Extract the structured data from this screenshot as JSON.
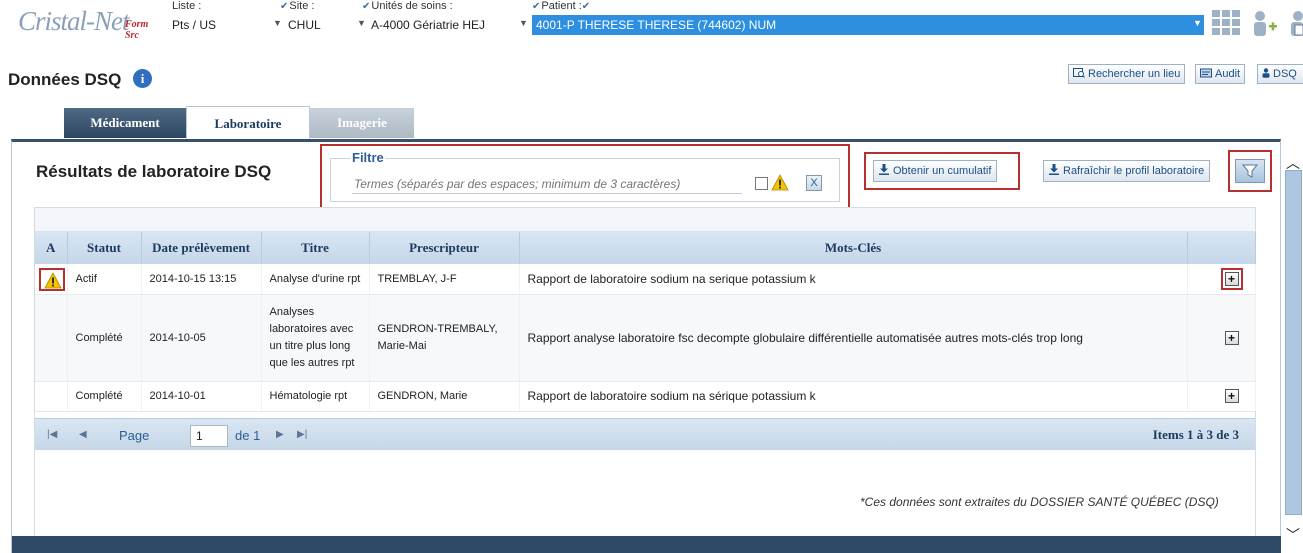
{
  "app": {
    "logo": "Cristal-Net",
    "form_src_line1": "Form",
    "form_src_line2": "Src"
  },
  "selectors": {
    "liste": {
      "label": "Liste :",
      "value": "Pts / US"
    },
    "site": {
      "label": "Site :",
      "value": "CHUL"
    },
    "unite": {
      "label": "Unités de soins :",
      "value": "A-4000 Gériatrie HEJ"
    },
    "patient": {
      "label": "Patient :",
      "value": "4001-P THERESE THERESE (744602) NUM"
    }
  },
  "header": {
    "title": "Données DSQ",
    "info_glyph": "i",
    "buttons": {
      "rechercher": "Rechercher un lieu",
      "audit": "Audit",
      "dsq": "DSQ"
    }
  },
  "tabs": [
    {
      "label": "Médicament"
    },
    {
      "label": "Laboratoire"
    },
    {
      "label": "Imagerie"
    }
  ],
  "panel": {
    "title": "Résultats de laboratoire DSQ",
    "filter": {
      "legend": "Filtre",
      "placeholder": "Termes (séparés par des espaces; minimum de 3 caractères)",
      "clear": "X"
    },
    "buttons": {
      "cumulatif": "Obtenir un cumulatif",
      "rafraichir": "Rafraîchir le profil laboratoire"
    }
  },
  "table": {
    "headers": [
      "A",
      "Statut",
      "Date prélèvement",
      "Titre",
      "Prescripteur",
      "Mots-Clés",
      ""
    ],
    "rows": [
      {
        "statut": "Actif",
        "date": "2014-10-15 13:15",
        "titre": "Analyse d'urine rpt",
        "prescripteur": "TREMBLAY, J-F",
        "mots_cles": "Rapport de laboratoire sodium na serique potassium k"
      },
      {
        "statut": "Complété",
        "date": "2014-10-05",
        "titre": "Analyses laboratoires avec un titre plus long que les autres rpt",
        "prescripteur": "GENDRON-TREMBALY, Marie-Mai",
        "mots_cles": "Rapport analyse laboratoire fsc decompte globulaire différentielle automatisée autres mots-clés trop long"
      },
      {
        "statut": "Complété",
        "date": "2014-10-01",
        "titre": "Hématologie rpt",
        "prescripteur": "GENDRON, Marie",
        "mots_cles": "Rapport de laboratoire sodium na sérique potassium k"
      }
    ],
    "expand_glyph": "+"
  },
  "pager": {
    "page_label": "Page",
    "page_value": "1",
    "of_label": "de 1",
    "items": "Items 1 à 3 de 3"
  },
  "footnote": "*Ces données sont extraites du DOSSIER SANTÉ QUÉBEC (DSQ)",
  "colors": {
    "accent": "#2e8fe0",
    "tab_dark": "#35516e",
    "highlight_outline": "#b5302e",
    "grid_header": "#c4d6e8"
  }
}
